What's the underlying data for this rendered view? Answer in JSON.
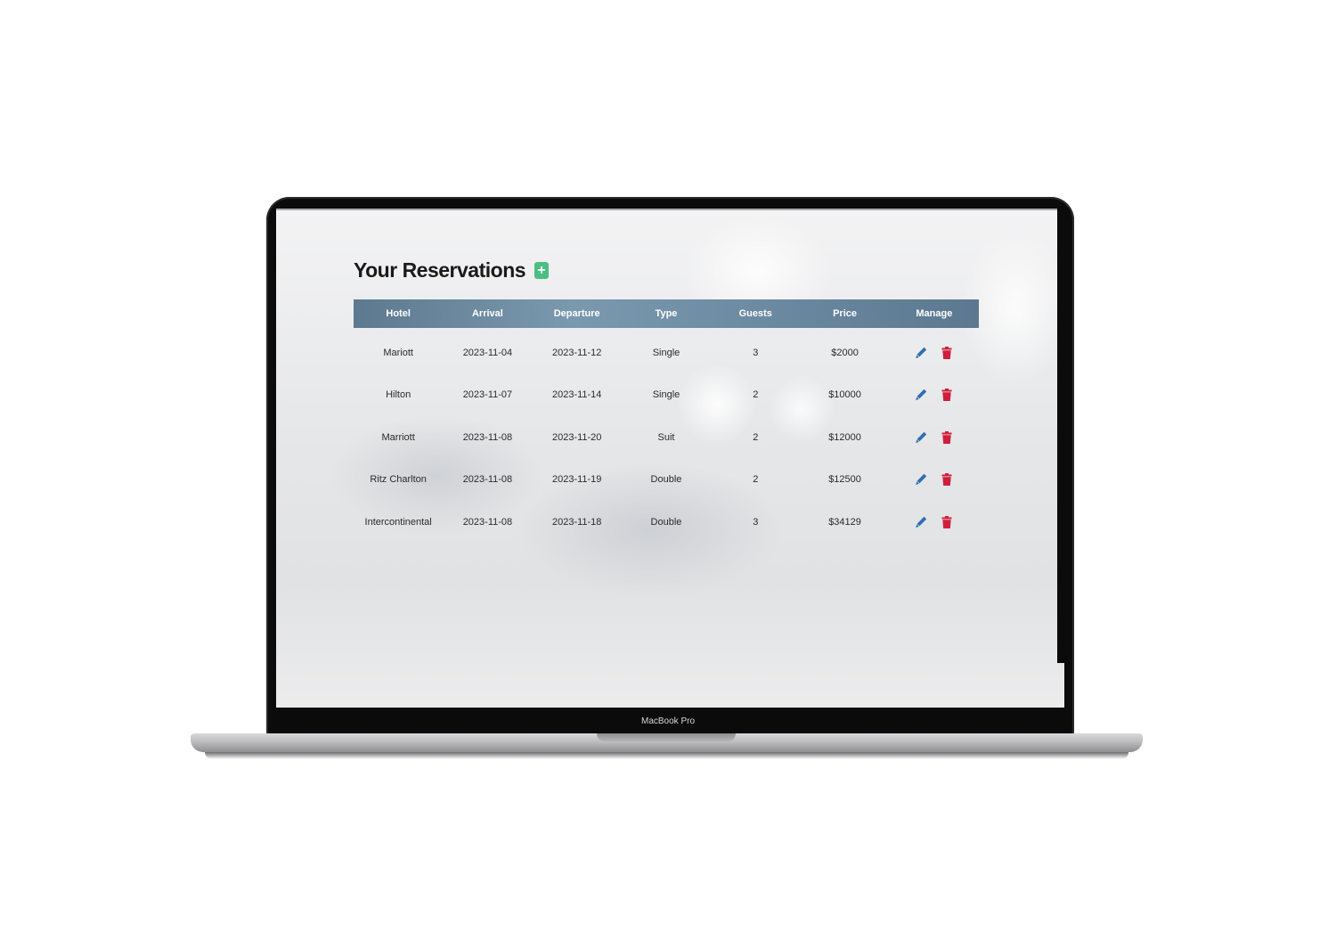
{
  "device": {
    "label": "MacBook Pro"
  },
  "page": {
    "title": "Your Reservations",
    "add_button_label": "+"
  },
  "table": {
    "headers": [
      "Hotel",
      "Arrival",
      "Departure",
      "Type",
      "Guests",
      "Price",
      "Manage"
    ],
    "rows": [
      {
        "hotel": "Mariott",
        "arrival": "2023-11-04",
        "departure": "2023-11-12",
        "type": "Single",
        "guests": "3",
        "price": "$2000"
      },
      {
        "hotel": "Hilton",
        "arrival": "2023-11-07",
        "departure": "2023-11-14",
        "type": "Single",
        "guests": "2",
        "price": "$10000"
      },
      {
        "hotel": "Marriott",
        "arrival": "2023-11-08",
        "departure": "2023-11-20",
        "type": "Suit",
        "guests": "2",
        "price": "$12000"
      },
      {
        "hotel": "Ritz Charlton",
        "arrival": "2023-11-08",
        "departure": "2023-11-19",
        "type": "Double",
        "guests": "2",
        "price": "$12500"
      },
      {
        "hotel": "Intercontinental",
        "arrival": "2023-11-08",
        "departure": "2023-11-18",
        "type": "Double",
        "guests": "3",
        "price": "$34129"
      }
    ]
  },
  "icons": {
    "edit": "pencil-icon",
    "delete": "trash-icon",
    "add": "plus-icon"
  },
  "colors": {
    "edit_icon": "#2f6fb0",
    "delete_icon": "#d01f3c",
    "add_button": "#4bbf83",
    "header_bar": "#6c8aa1"
  }
}
